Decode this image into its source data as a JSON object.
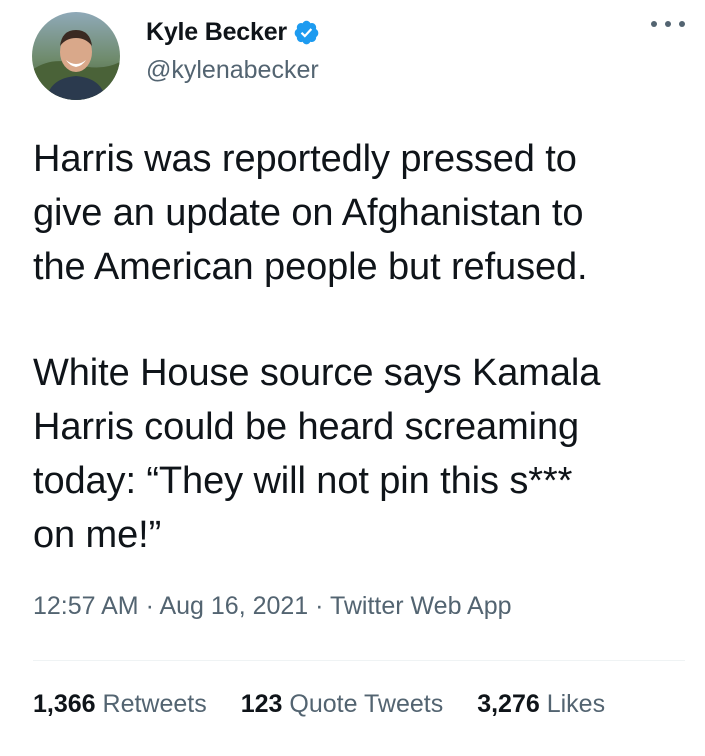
{
  "author": {
    "display_name": "Kyle Becker",
    "handle": "@kylenabecker",
    "verified": true,
    "verified_color": "#1d9bf0"
  },
  "tweet": {
    "paragraphs": [
      {
        "lines": [
          "Harris was reportedly pressed to",
          "give an update on Afghanistan to",
          "the American people but refused."
        ]
      },
      {
        "lines": [
          "White House source says Kamala",
          "Harris could be heard screaming",
          "today: “They will not pin this s***",
          "on me!”"
        ]
      }
    ],
    "meta": "12:57 AM · Aug 16, 2021 · Twitter Web App"
  },
  "stats": [
    {
      "count": "1,366",
      "label": "Retweets"
    },
    {
      "count": "123",
      "label": "Quote Tweets"
    },
    {
      "count": "3,276",
      "label": "Likes"
    }
  ],
  "icons": {
    "more": "more-horizontal-icon",
    "verified": "verified-badge-icon"
  }
}
